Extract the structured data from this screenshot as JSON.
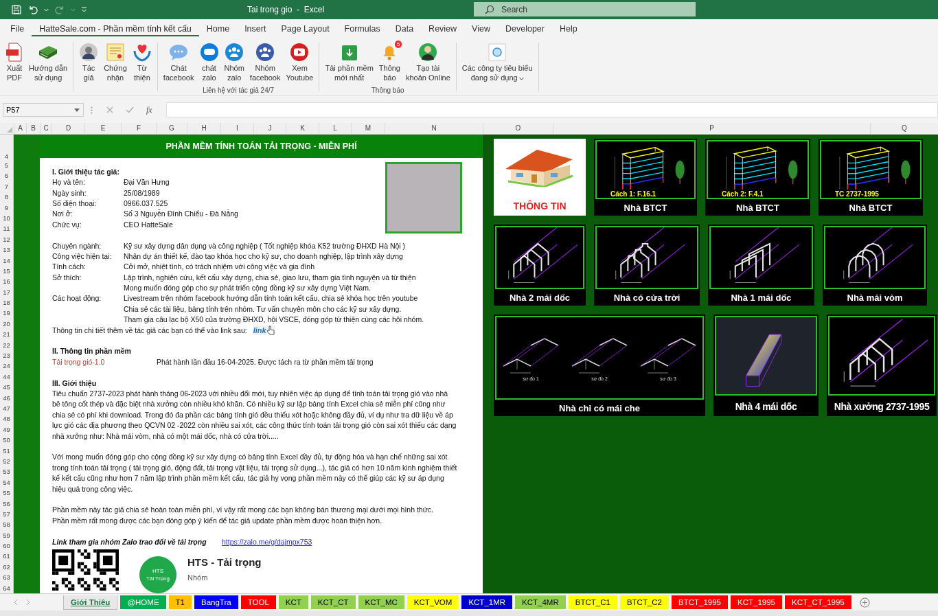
{
  "window": {
    "title": "Tai trong gio  -  Excel"
  },
  "search": {
    "placeholder": "Search"
  },
  "menu_tabs": [
    {
      "label": "File",
      "selected": false
    },
    {
      "label": "HatteSale.com - Phần mềm tính kết cấu",
      "selected": true
    },
    {
      "label": "Home",
      "selected": false
    },
    {
      "label": "Insert",
      "selected": false
    },
    {
      "label": "Page Layout",
      "selected": false
    },
    {
      "label": "Formulas",
      "selected": false
    },
    {
      "label": "Data",
      "selected": false
    },
    {
      "label": "Review",
      "selected": false
    },
    {
      "label": "View",
      "selected": false
    },
    {
      "label": "Developer",
      "selected": false
    },
    {
      "label": "Help",
      "selected": false
    }
  ],
  "ribbon_groups": [
    {
      "buttons": [
        {
          "kind": "pdf",
          "label": "Xuất\nPDF"
        },
        {
          "kind": "book",
          "label": "Hướng dẫn\nsử dụng"
        }
      ]
    },
    {
      "buttons": [
        {
          "kind": "avatar",
          "label": "Tác\ngiả"
        },
        {
          "kind": "certificate",
          "label": "Chứng\nnhận"
        },
        {
          "kind": "charity",
          "label": "Từ\nthiện"
        }
      ]
    },
    {
      "label": "Liên hệ với tác giả 24/7",
      "buttons": [
        {
          "kind": "chat",
          "label": "Chát\nfacebook"
        },
        {
          "kind": "zalo",
          "label": "chát\nzalo"
        },
        {
          "kind": "group",
          "label": "Nhóm\nzalo"
        },
        {
          "kind": "group",
          "label": "Nhóm\nfacebook"
        },
        {
          "kind": "youtube",
          "label": "Xem\nYoutube"
        }
      ]
    },
    {
      "label": "Thông báo",
      "buttons": [
        {
          "kind": "download",
          "label": "Tải phần mềm\nmới nhất"
        },
        {
          "kind": "bell",
          "label": "Thông\nbáo",
          "badge": "5"
        },
        {
          "kind": "account",
          "label": "Tạo tài\nkhoản Online"
        }
      ]
    },
    {
      "buttons": [
        {
          "kind": "company",
          "label": "Các công ty tiêu biểu\nđang sử dụng",
          "dropdown": true
        }
      ]
    }
  ],
  "formula_bar": {
    "name_box": "P57",
    "function_label": "fx"
  },
  "columns": [
    "A",
    "B",
    "C",
    "D",
    "E",
    "F",
    "G",
    "H",
    "I",
    "J",
    "K",
    "L",
    "M",
    "N",
    "O",
    "P",
    "Q"
  ],
  "row_numbers": [
    "4",
    "5",
    "6",
    "7",
    "8",
    "9",
    "10",
    "11",
    "12",
    "13",
    "14",
    "15",
    "16",
    "17",
    "18",
    "19",
    "20",
    "21",
    "22",
    "23",
    "24",
    "44",
    "45",
    "46",
    "47",
    "48",
    "49",
    "50",
    "51",
    "52",
    "53",
    "54",
    "55",
    "56",
    "57",
    "58",
    "59",
    "60",
    "61",
    "62",
    "63",
    "64"
  ],
  "banner": "PHẦN MỀM TÍNH TOÁN TẢI TRỌNG - MIỄN PHÍ",
  "author": {
    "heading": "I. Giới thiệu tác giả:",
    "personal": [
      {
        "label": "Họ và tên:",
        "lines": [
          "Đại Văn Hưng"
        ]
      },
      {
        "label": "Ngày sinh:",
        "lines": [
          "25/08/1989"
        ]
      },
      {
        "label": "Số điện thoại:",
        "lines": [
          "0966.037.525"
        ]
      },
      {
        "label": "Nơi ở:",
        "lines": [
          "Số 3 Nguyễn Đình Chiểu - Đà Nẵng"
        ]
      },
      {
        "label": "Chức vụ:",
        "lines": [
          "CEO  HatteSale"
        ]
      }
    ],
    "profile": [
      {
        "label": "Chuyên ngành:",
        "lines": [
          "Kỹ sư xây dựng dân dụng và công nghiệp ( Tốt nghiệp khóa K52 trường ĐHXD Hà Nội )"
        ]
      },
      {
        "label": "Công việc hiện tại:",
        "lines": [
          "Nhận dự án thiết kế, đào tạo khóa học cho kỹ sư, cho doanh nghiệp, lập trình xây dựng"
        ]
      },
      {
        "label": "Tính cách:",
        "lines": [
          "Cởi mở, nhiệt tình, có trách nhiệm với công việc và gia đình"
        ]
      },
      {
        "label": "Sở thích:",
        "lines": [
          "Lập trình, nghiên cứu, kết cấu xây dựng, chia sẻ, giao lưu, tham gia tình nguyện và từ thiện",
          "Mong muốn đóng góp cho sự phát triển cộng đồng kỹ sư xây dựng Việt Nam."
        ]
      },
      {
        "label": "Các hoạt động:",
        "lines": [
          "Livestream trên nhóm facebook hướng dẫn tính toán kết cấu, chia sẻ khóa học trên youtube",
          "Chia sẻ các tài liệu, bảng tính trên nhóm. Tư vấn chuyên môn cho các kỹ sư xây dựng.",
          "Tham gia câu lạc bộ X50 của trường ĐHXD, hội VSCE, đóng góp từ thiện cùng các hội nhóm."
        ]
      }
    ],
    "more_info": "Thông tin chi tiết thêm về tác giả các bạn có thể vào link sau:",
    "link_badge": "link"
  },
  "software": {
    "heading": "II. Thông tin phần mềm",
    "name": "Tải trọng gió-1.0",
    "release": "Phát hành lần đầu 16-04-2025. Được tách ra từ phần mềm tải trọng"
  },
  "intro": {
    "heading": "III. Giới thiệu",
    "paragraphs": [
      {
        "lines": [
          "Tiêu chuẩn 2737-2023 phát hành tháng 06-2023 với nhiều đổi mới, tuy nhiên việc áp dụng để tính toán tải trọng gió vào nhà bê tông cốt thép và đặc biệt nhà xưởng còn nhiều khó khăn. Có nhiều kỹ sư lập bảng tính Excel chia sẻ  miễn phí cũng như chia sẻ có phí khi download. Trong đó đa phần các bảng tính gió đều thiếu xót hoặc không đầy đủ, ví dụ như tra  dữ liệu về áp lực gió các địa phương theo QCVN 02 -2022 còn nhiều sai xót, các công thức tính toán tải trọng gió còn sai xót thiếu các dạng nhà xưởng như: Nhà mái vòm, nhà có một mái dốc, nhà có cửa trời....."
        ]
      },
      {
        "lines": [
          "Với mong muốn đóng góp cho cộng đồng kỹ sư xây dựng có bảng tính Excel đầy đủ, tự động hóa và hạn chế những sai xót trong tính toán tải trọng ( tải trọng gió, động đất, tải trọng vật liệu, tải trọng sử dụng...), tác giả có hơn 10 năm kinh nghiệm thiết kế kết cấu cũng như hơn 7 năm lập trình phần mềm kết cấu, tác giả hy vọng phần mềm này có thể giúp các kỹ sư áp dụng hiệu quả trong công việc."
        ]
      },
      {
        "lines": [
          "Phần mềm này tác giả chia sẻ hoàn toàn miễn phí, vì vậy rất mong các bạn không bán thương mại dưới mọi hình thức.",
          "Phần mềm rất mong được các bạn đóng góp ý kiến để tác giả update phần mềm được hoàn thiện hơn."
        ]
      }
    ]
  },
  "zalo": {
    "label": "Link tham gia nhóm Zalo trao đổi về tải trọng",
    "url": "https://zalo.me/g/dajmpx753",
    "avatar_lines": [
      "HTS",
      "Tải Trọng"
    ],
    "group_name": "HTS - Tải trọng",
    "group_type": "Nhóm"
  },
  "tile_rows": [
    {
      "tiles": [
        {
          "kind": "info",
          "caption": "THÔNG TIN"
        },
        {
          "kind": "building",
          "caption": "Nhà BTCT",
          "tag": "Cách 1: F.16.1"
        },
        {
          "kind": "building",
          "caption": "Nhà BTCT",
          "tag": "Cách 2: F.4.1"
        },
        {
          "kind": "building",
          "caption": "Nhà BTCT",
          "tag": "TC 2737-1995"
        }
      ]
    },
    {
      "tiles": [
        {
          "kind": "gable",
          "caption": "Nhà 2 mái dốc"
        },
        {
          "kind": "monitor",
          "caption": "Nhà có cửa trời"
        },
        {
          "kind": "monoslope",
          "caption": "Nhà 1 mái dốc"
        },
        {
          "kind": "arch",
          "caption": "Nhà mái vòm"
        }
      ]
    },
    {
      "tiles": [
        {
          "kind": "canopy",
          "caption": "Nhà chỉ có mái che",
          "diagrams": [
            "sơ đồ 1",
            "sơ đồ 2",
            "sơ đồ 3"
          ]
        },
        {
          "kind": "hip",
          "caption": "Nhà 4 mái dốc"
        },
        {
          "kind": "gable",
          "caption": "Nhà xưởng 2737-1995"
        }
      ]
    }
  ],
  "sheet_tabs": [
    {
      "label": "Giới Thiệu",
      "selected": true,
      "color": "#e8e8e8"
    },
    {
      "label": "@HOME",
      "selected": false,
      "color": "#00b050"
    },
    {
      "label": "T1",
      "selected": false,
      "color": "#ffc000"
    },
    {
      "label": "BangTra",
      "selected": false,
      "color": "#0000ff"
    },
    {
      "label": "TOOL",
      "selected": false,
      "color": "#ff0000"
    },
    {
      "label": "KCT",
      "selected": false,
      "color": "#92d050"
    },
    {
      "label": "KCT_CT",
      "selected": false,
      "color": "#92d050"
    },
    {
      "label": "KCT_MC",
      "selected": false,
      "color": "#92d050"
    },
    {
      "label": "KCT_VOM",
      "selected": false,
      "color": "#ffff00"
    },
    {
      "label": "KCT_1MR",
      "selected": false,
      "color": "#0000cc"
    },
    {
      "label": "KCT_4MR",
      "selected": false,
      "color": "#92d050"
    },
    {
      "label": "BTCT_C1",
      "selected": false,
      "color": "#ffff00"
    },
    {
      "label": "BTCT_C2",
      "selected": false,
      "color": "#ffff00"
    },
    {
      "label": "BTCT_1995",
      "selected": false,
      "color": "#ff0000"
    },
    {
      "label": "KCT_1995",
      "selected": false,
      "color": "#ff0000"
    },
    {
      "label": "KCT_CT_1995",
      "selected": false,
      "color": "#ff0000"
    }
  ]
}
